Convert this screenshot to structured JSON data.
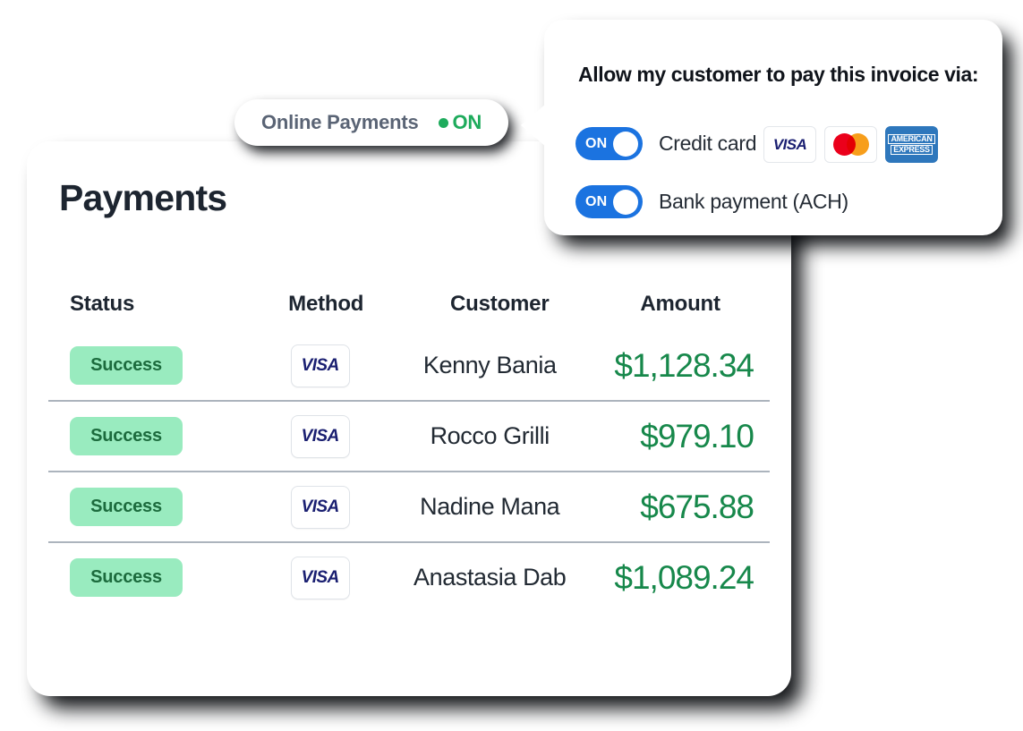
{
  "card": {
    "title": "Payments"
  },
  "pill": {
    "label": "Online Payments",
    "state": "ON"
  },
  "popover": {
    "title": "Allow my customer to pay this invoice via:",
    "options": [
      {
        "toggle": "ON",
        "label": "Credit card"
      },
      {
        "toggle": "ON",
        "label": "Bank payment (ACH)"
      }
    ],
    "brands": [
      {
        "name": "visa",
        "text": "VISA"
      },
      {
        "name": "mastercard",
        "text": ""
      },
      {
        "name": "amex",
        "line1": "AMERICAN",
        "line2": "EXPRESS"
      }
    ]
  },
  "table": {
    "columns": [
      "Status",
      "Method",
      "Customer",
      "Amount"
    ],
    "rows": [
      {
        "status": "Success",
        "method": "VISA",
        "customer": "Kenny Bania",
        "amount": "$1,128.34"
      },
      {
        "status": "Success",
        "method": "VISA",
        "customer": "Rocco Grilli",
        "amount": "$979.10"
      },
      {
        "status": "Success",
        "method": "VISA",
        "customer": "Nadine Mana",
        "amount": "$675.88"
      },
      {
        "status": "Success",
        "method": "VISA",
        "customer": "Anastasia Dab",
        "amount": "$1,089.24"
      }
    ]
  },
  "colors": {
    "accent_blue": "#1b73e0",
    "success_green": "#1eab5c",
    "amount_green": "#17884b",
    "badge_bg": "#99ebbf",
    "badge_text": "#1c6b3d",
    "visa_navy": "#1a1f71",
    "amex_blue": "#2e77bc",
    "text_dark": "#1d2530"
  }
}
